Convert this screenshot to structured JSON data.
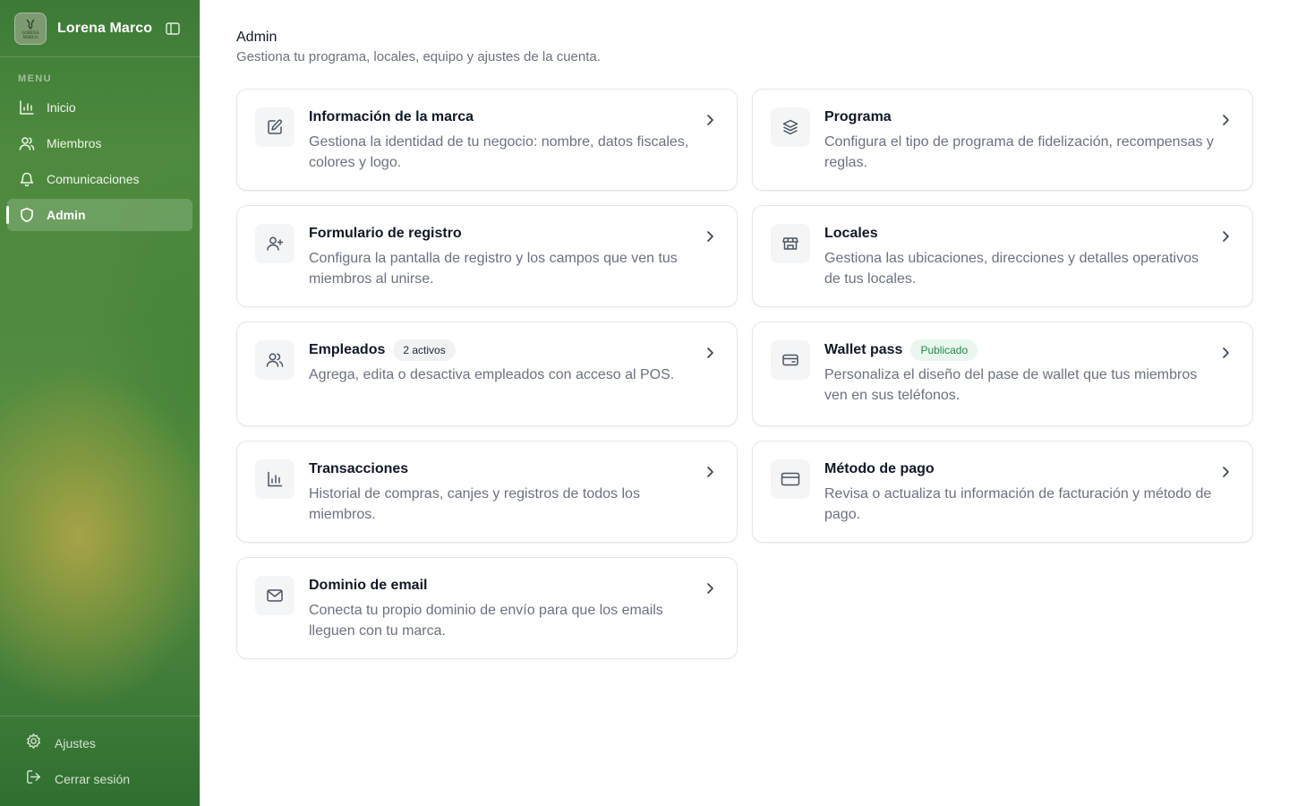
{
  "sidebar": {
    "brand_name": "Lorena Marco",
    "logo_text": "LORENA MARCO",
    "menu_heading": "MENU",
    "items": [
      {
        "label": "Inicio",
        "icon": "bar-chart-icon"
      },
      {
        "label": "Miembros",
        "icon": "users-icon"
      },
      {
        "label": "Comunicaciones",
        "icon": "bell-icon"
      },
      {
        "label": "Admin",
        "icon": "shield-icon",
        "active": true
      }
    ],
    "bottom": [
      {
        "label": "Ajustes",
        "icon": "gear-icon"
      },
      {
        "label": "Cerrar sesión",
        "icon": "logout-icon"
      }
    ]
  },
  "header": {
    "title": "Admin",
    "subtitle": "Gestiona tu programa, locales, equipo y ajustes de la cuenta."
  },
  "cards": [
    {
      "title": "Información de la marca",
      "desc": "Gestiona la identidad de tu negocio: nombre, datos fiscales, colores y logo.",
      "icon": "edit-icon"
    },
    {
      "title": "Programa",
      "desc": "Configura el tipo de programa de fidelización, recompensas y reglas.",
      "icon": "layers-icon"
    },
    {
      "title": "Formulario de registro",
      "desc": "Configura la pantalla de registro y los campos que ven tus miembros al unirse.",
      "icon": "user-plus-icon"
    },
    {
      "title": "Locales",
      "desc": "Gestiona las ubicaciones, direcciones y detalles operativos de tus locales.",
      "icon": "store-icon"
    },
    {
      "title": "Empleados",
      "badge": "2 activos",
      "desc": "Agrega, edita o desactiva empleados con acceso al POS.",
      "icon": "users-icon"
    },
    {
      "title": "Wallet pass",
      "badge": "Publicado",
      "desc": "Personaliza el diseño del pase de wallet que tus miembros ven en sus teléfonos.",
      "icon": "wallet-icon"
    },
    {
      "title": "Transacciones",
      "desc": "Historial de compras, canjes y registros de todos los miembros.",
      "icon": "bar-chart-icon"
    },
    {
      "title": "Método de pago",
      "desc": "Revisa o actualiza tu información de facturación y método de pago.",
      "icon": "credit-card-icon"
    },
    {
      "title": "Dominio de email",
      "desc": "Conecta tu propio dominio de envío para que los emails lleguen con tu marca.",
      "icon": "mail-icon"
    }
  ],
  "colors": {
    "sidebar_green": "#4f8a3f",
    "badge_success_text": "#1e8a4a",
    "badge_success_bg": "#e9f7ee"
  }
}
